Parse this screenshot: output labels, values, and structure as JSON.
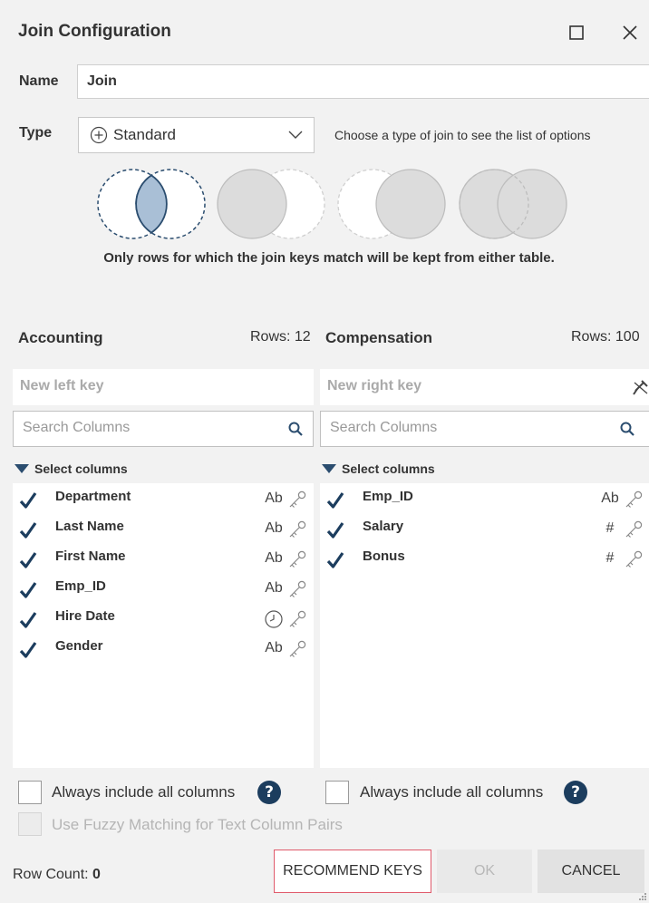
{
  "dialog": {
    "title": "Join Configuration"
  },
  "name_field": {
    "label": "Name",
    "value": "Join"
  },
  "type_field": {
    "label": "Type",
    "selected": "Standard",
    "hint": "Choose a type of join to see the list of options"
  },
  "join_types": [
    {
      "icon": "inner-join-icon",
      "selected": true
    },
    {
      "icon": "left-join-icon",
      "selected": false
    },
    {
      "icon": "right-join-icon",
      "selected": false
    },
    {
      "icon": "full-outer-join-icon",
      "selected": false
    }
  ],
  "join_description": "Only rows for which the join keys match will be kept from either table.",
  "left": {
    "table": "Accounting",
    "rows_label": "Rows: 12",
    "key_placeholder": "New left key",
    "search_placeholder": "Search Columns",
    "select_header": "Select columns",
    "columns": [
      {
        "name": "Department",
        "type": "Ab",
        "checked": true
      },
      {
        "name": "Last Name",
        "type": "Ab",
        "checked": true
      },
      {
        "name": "First Name",
        "type": "Ab",
        "checked": true
      },
      {
        "name": "Emp_ID",
        "type": "Ab",
        "checked": true
      },
      {
        "name": "Hire Date",
        "type": "clock",
        "checked": true
      },
      {
        "name": "Gender",
        "type": "Ab",
        "checked": true
      }
    ],
    "always_include": "Always include all columns"
  },
  "right": {
    "table": "Compensation",
    "rows_label": "Rows: 100",
    "key_placeholder": "New right key",
    "search_placeholder": "Search Columns",
    "select_header": "Select columns",
    "columns": [
      {
        "name": "Emp_ID",
        "type": "Ab",
        "checked": true
      },
      {
        "name": "Salary",
        "type": "#",
        "checked": true
      },
      {
        "name": "Bonus",
        "type": "#",
        "checked": true
      }
    ],
    "always_include": "Always include all columns"
  },
  "fuzzy": "Use Fuzzy Matching for Text Column Pairs",
  "footer": {
    "row_count_label": "Row Count:",
    "row_count_value": "0",
    "recommend": "RECOMMEND KEYS",
    "ok": "OK",
    "cancel": "CANCEL"
  },
  "colors": {
    "accent": "#2b4d6f",
    "recommend_border": "#e05a6b",
    "venn_selected": "#a9bfd6"
  }
}
